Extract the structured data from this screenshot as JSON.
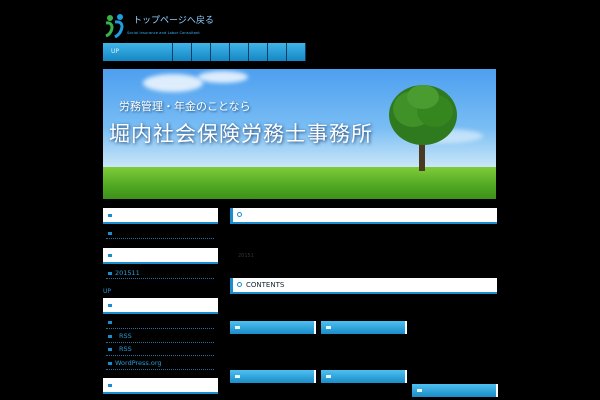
{
  "header": {
    "logo_text": "トップページへ戻る",
    "logo_sub": "Social Insurance and Labor Consultant"
  },
  "nav": {
    "items": [
      "UP",
      "",
      "",
      "",
      "",
      "",
      "",
      ""
    ]
  },
  "banner": {
    "line1": "労務管理・年金のことなら",
    "line2": "堀内社会保険労務士事務所"
  },
  "sidebar": {
    "archive_link": "201511",
    "up_link": "UP",
    "rss1": "RSS",
    "rss2": "RSS",
    "wordpress": "WordPress.org"
  },
  "main": {
    "post_date": "20151",
    "contents_title": "CONTENTS"
  },
  "colors": {
    "background": "#000000",
    "accent": "#1b8ccc",
    "link": "#2a9ad6"
  }
}
